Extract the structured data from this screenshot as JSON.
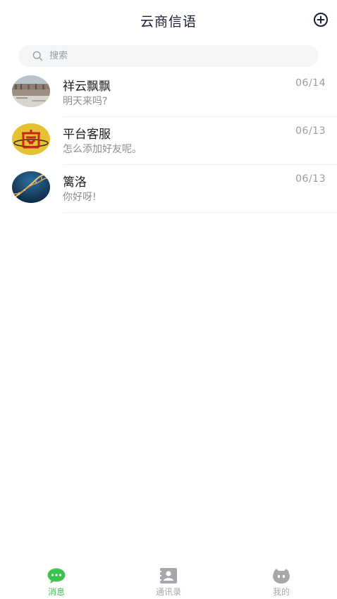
{
  "header": {
    "title": "云商信语",
    "add_icon": "plus-circle-icon"
  },
  "search": {
    "placeholder": "搜索",
    "value": "",
    "icon": "search-icon"
  },
  "conversations": [
    {
      "name": "祥云飘飘",
      "preview": "明天来吗?",
      "time": "06/14",
      "avatar": "landscape-photo"
    },
    {
      "name": "平台客服",
      "preview": "怎么添加好友呢。",
      "time": "06/13",
      "avatar": "shang-logo"
    },
    {
      "name": "篱洛",
      "preview": "你好呀!",
      "time": "06/13",
      "avatar": "dna-helix-image"
    }
  ],
  "tabbar": {
    "tabs": [
      {
        "label": "消息",
        "icon": "chat-bubble-icon",
        "active": true
      },
      {
        "label": "通讯录",
        "icon": "contacts-book-icon",
        "active": false
      },
      {
        "label": "我的",
        "icon": "profile-face-icon",
        "active": false
      }
    ]
  },
  "colors": {
    "accent": "#3cc34f",
    "title": "#1a1f3a",
    "muted": "#8a8d93",
    "search_bg": "#f4f5f7"
  }
}
